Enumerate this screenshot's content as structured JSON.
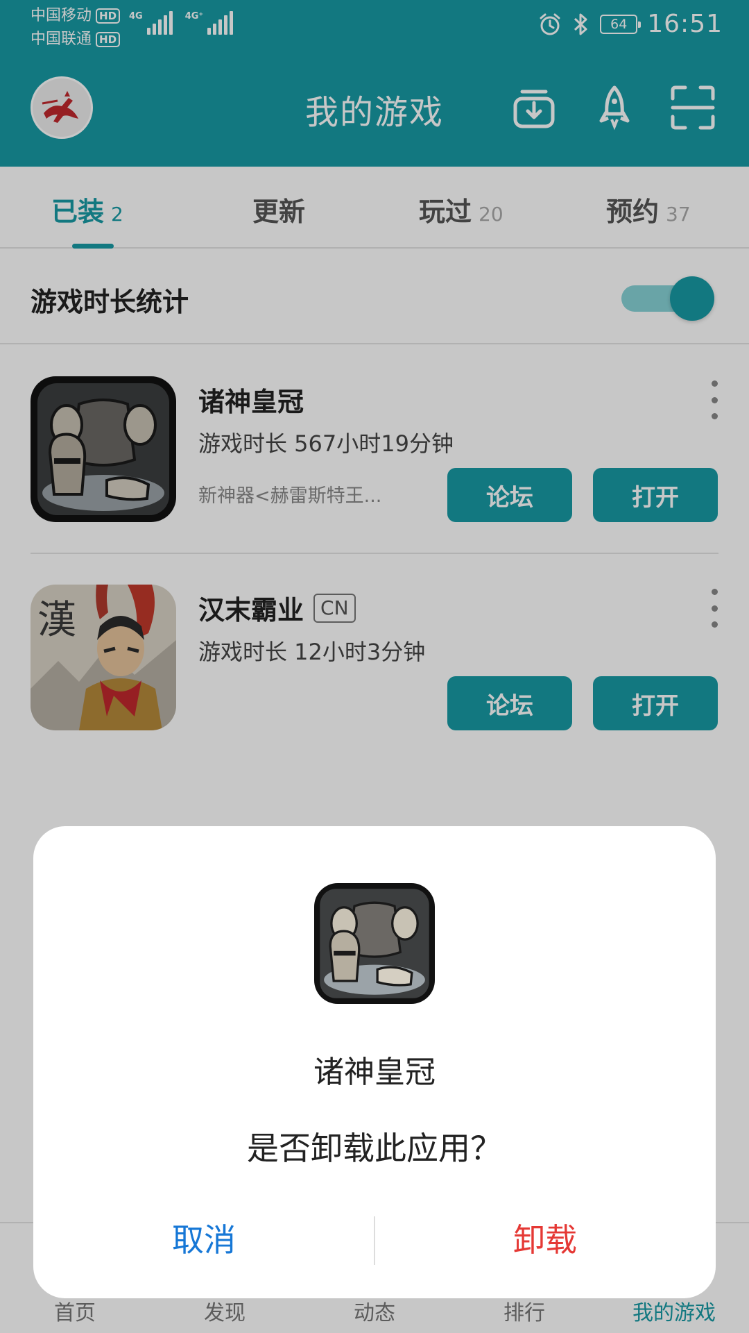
{
  "status_bar": {
    "carrier_1": "中国移动",
    "carrier_2": "中国联通",
    "hd_badge": "HD",
    "network_1": "4G",
    "network_2": "4G⁺",
    "battery": "64",
    "time": "16:51"
  },
  "header": {
    "title": "我的游戏"
  },
  "tabs": [
    {
      "label": "已装",
      "count": "2",
      "active": true
    },
    {
      "label": "更新",
      "count": "",
      "active": false
    },
    {
      "label": "玩过",
      "count": "20",
      "active": false
    },
    {
      "label": "预约",
      "count": "37",
      "active": false
    }
  ],
  "stats": {
    "label": "游戏时长统计",
    "enabled": true
  },
  "games": [
    {
      "name": "诸神皇冠",
      "badge": "",
      "playtime": "游戏时长 567小时19分钟",
      "news": "新神器<赫雷斯特王...",
      "forum_label": "论坛",
      "open_label": "打开"
    },
    {
      "name": "汉末霸业",
      "badge": "CN",
      "playtime": "游戏时长 12小时3分钟",
      "news": "",
      "forum_label": "论坛",
      "open_label": "打开",
      "icon_text": "漢"
    }
  ],
  "bottom_nav": [
    {
      "label": "首页",
      "active": false
    },
    {
      "label": "发现",
      "active": false
    },
    {
      "label": "动态",
      "active": false
    },
    {
      "label": "排行",
      "active": false
    },
    {
      "label": "我的游戏",
      "active": true
    }
  ],
  "dialog": {
    "app_name": "诸神皇冠",
    "message": "是否卸载此应用？",
    "cancel_label": "取消",
    "confirm_label": "卸载"
  },
  "colors": {
    "accent": "#189aa5",
    "cancel": "#1677d6",
    "danger": "#e53935"
  }
}
